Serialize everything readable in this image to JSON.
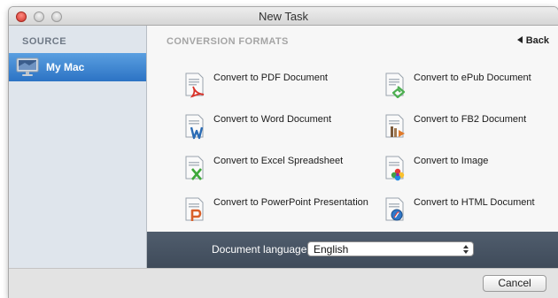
{
  "window": {
    "title": "New Task"
  },
  "sidebar": {
    "heading": "SOURCE",
    "items": [
      {
        "label": "My Mac",
        "icon": "imac-icon"
      }
    ]
  },
  "main": {
    "heading": "CONVERSION FORMATS",
    "back_label": "Back",
    "formats": [
      {
        "label": "Convert to PDF Document",
        "icon": "pdf-document-icon"
      },
      {
        "label": "Convert to ePub Document",
        "icon": "epub-document-icon"
      },
      {
        "label": "Convert to Word Document",
        "icon": "word-document-icon"
      },
      {
        "label": "Convert to FB2 Document",
        "icon": "fb2-document-icon"
      },
      {
        "label": "Convert to Excel Spreadsheet",
        "icon": "excel-spreadsheet-icon"
      },
      {
        "label": "Convert to Image",
        "icon": "image-document-icon"
      },
      {
        "label": "Convert to PowerPoint Presentation",
        "icon": "powerpoint-document-icon"
      },
      {
        "label": "Convert to HTML Document",
        "icon": "html-document-icon"
      }
    ]
  },
  "language": {
    "label": "Document language:",
    "value": "English"
  },
  "footer": {
    "cancel_label": "Cancel"
  },
  "colors": {
    "selection": "#3a86d4",
    "bottom_bar": "#46525f",
    "pdf": "#d9342b",
    "epub": "#4caf50",
    "word": "#2b6cb5",
    "fb2": "#7a5a3c",
    "excel": "#3ea83a",
    "powerpoint": "#d9612b",
    "html": "#2f78c9"
  }
}
